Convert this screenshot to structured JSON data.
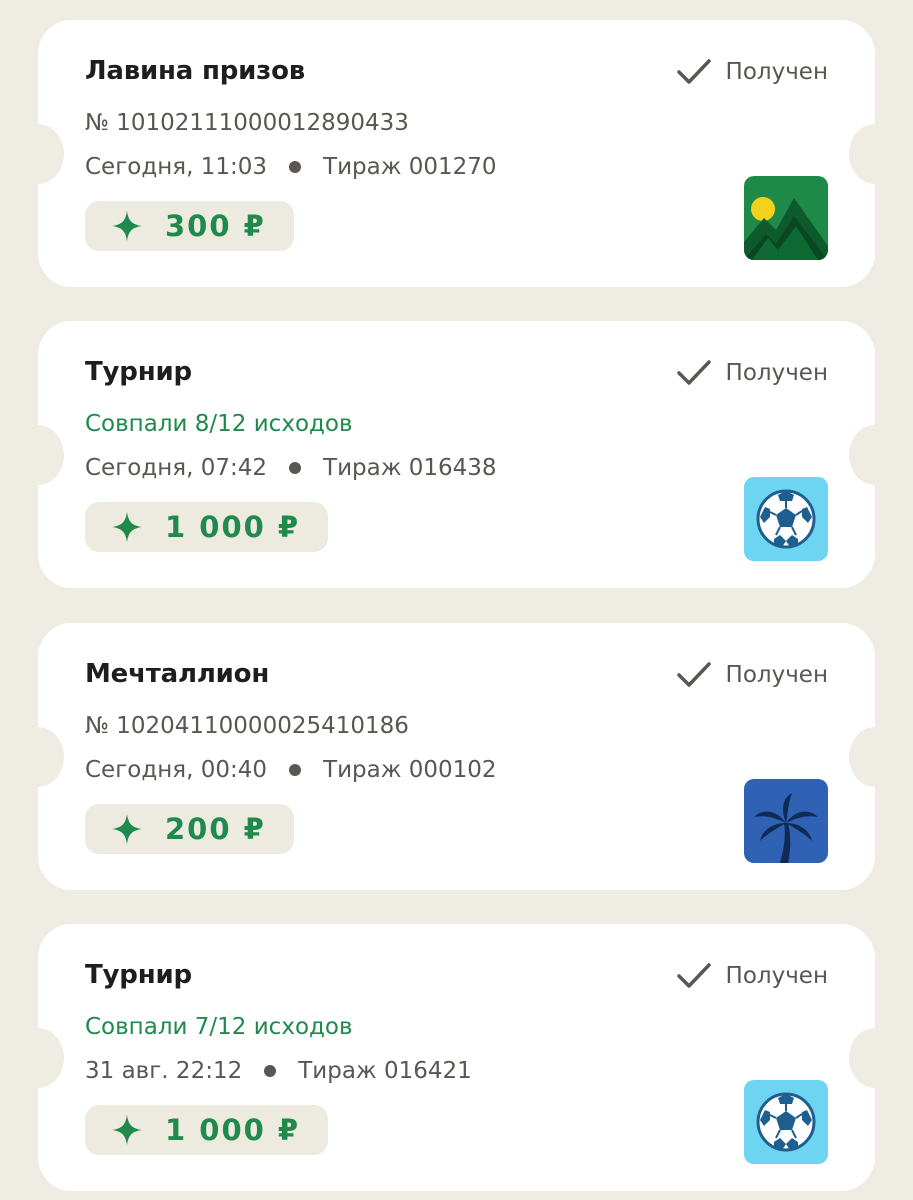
{
  "tickets": [
    {
      "title": "Лавина призов",
      "status": "Получен",
      "subtitle": "№ 101021110000128904​33",
      "subtitle_green": false,
      "date": "Сегодня, 11:03",
      "draw": "Тираж 001270",
      "prize": "300 ₽",
      "game_icon": "mountains-sun-icon"
    },
    {
      "title": "Турнир",
      "status": "Получен",
      "subtitle": "Совпали 8/12 исходов",
      "subtitle_green": true,
      "date": "Сегодня, 07:42",
      "draw": "Тираж 016438",
      "prize": "1 000 ₽",
      "game_icon": "soccer-ball-icon"
    },
    {
      "title": "Мечталлион",
      "status": "Получен",
      "subtitle": "№ 10204110000025410186",
      "subtitle_green": false,
      "date": "Сегодня, 00:40",
      "draw": "Тираж 000102",
      "prize": "200 ₽",
      "game_icon": "palm-tree-icon"
    },
    {
      "title": "Турнир",
      "status": "Получен",
      "subtitle": "Совпали 7/12 исходов",
      "subtitle_green": true,
      "date": "31 авг. 22:12",
      "draw": "Тираж 016421",
      "prize": "1 000 ₽",
      "game_icon": "soccer-ball-icon"
    }
  ],
  "colors": {
    "background": "#efede3",
    "card": "#ffffff",
    "accent_green": "#1f8a4c",
    "text_dark": "#1e1e1e",
    "text_muted": "#5a5652",
    "prize_pill": "#edebe0"
  }
}
